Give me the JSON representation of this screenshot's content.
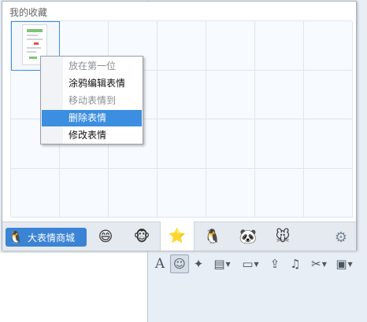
{
  "panel": {
    "title": "我的收藏"
  },
  "context_menu": {
    "items": [
      {
        "label": "放在第一位",
        "enabled": false,
        "highlighted": false
      },
      {
        "label": "涂鸦编辑表情",
        "enabled": true,
        "highlighted": false
      },
      {
        "label": "移动表情到",
        "enabled": false,
        "highlighted": false
      },
      {
        "label": "删除表情",
        "enabled": true,
        "highlighted": true
      },
      {
        "label": "修改表情",
        "enabled": true,
        "highlighted": false
      }
    ]
  },
  "bottom_bar": {
    "shop_button_label": "大表情商城",
    "tabs": [
      {
        "icon": "smiley-face-icon",
        "glyph": "😄"
      },
      {
        "icon": "monkey-face-icon",
        "glyph": "🐵"
      },
      {
        "icon": "star-favorites-icon",
        "glyph": "⭐",
        "active": true
      },
      {
        "icon": "penguin-face-icon",
        "glyph": "🐧"
      },
      {
        "icon": "panda-face-icon",
        "glyph": "🐼"
      },
      {
        "icon": "mouse-face-icon",
        "glyph": "🐭"
      }
    ],
    "settings_icon": "gear-icon"
  },
  "chat_toolbar": {
    "items": [
      {
        "icon": "font-icon",
        "glyph": "A"
      },
      {
        "icon": "emoji-icon",
        "glyph": "☺",
        "active": true
      },
      {
        "icon": "magic-wand-icon",
        "glyph": "✦"
      },
      {
        "icon": "gif-sticker-icon",
        "glyph": "▤",
        "dropdown": true
      },
      {
        "icon": "image-icon",
        "glyph": "▭",
        "dropdown": true
      },
      {
        "icon": "upload-icon",
        "glyph": "⇪"
      },
      {
        "icon": "music-icon",
        "glyph": "♫"
      },
      {
        "icon": "screenshot-scissors-icon",
        "glyph": "✂",
        "dropdown": true
      },
      {
        "icon": "message-record-icon",
        "glyph": "▣",
        "dropdown": true
      }
    ]
  },
  "colors": {
    "menu_highlight": "#3c8ee0",
    "shop_button": "#3b83d4",
    "selected_cell_border": "#3c8ede"
  }
}
